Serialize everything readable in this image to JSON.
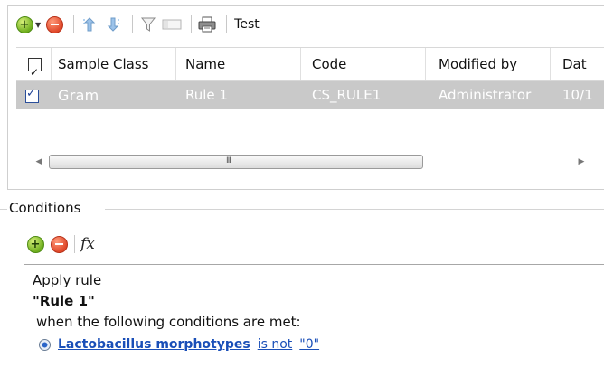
{
  "toolbar": {
    "buttons": [
      "add-icon",
      "dropdown-arrow-icon",
      "remove-icon",
      "move-up-icon",
      "move-down-icon",
      "filter-icon",
      "column-icon",
      "print-icon"
    ],
    "test_label": "Test"
  },
  "grid": {
    "columns": [
      "Sample Class",
      "Name",
      "Code",
      "Modified by",
      "Date"
    ],
    "header_visible": [
      "Sample Class",
      "Name",
      "Code",
      "Modified by",
      "Dat"
    ],
    "rows": [
      {
        "checked": true,
        "sample_class": "Gram",
        "name": "Rule 1",
        "code": "CS_RULE1",
        "modified_by": "Administrator",
        "date_visible": "10/1"
      }
    ],
    "scroll_grip": "III"
  },
  "conditions": {
    "title": "Conditions",
    "fx_label": "fx",
    "apply_text": "Apply rule",
    "rule_name": "\"Rule 1\"",
    "when_text": "when the following conditions are met:",
    "condition": {
      "field": "Lactobacillus morphotypes",
      "operator": "is not",
      "value": "\"0\""
    }
  },
  "colors": {
    "selected_row": "#c9c9c9",
    "link": "#1a4fb8",
    "add_green": "#6fae1e",
    "remove_red": "#e0482a"
  }
}
